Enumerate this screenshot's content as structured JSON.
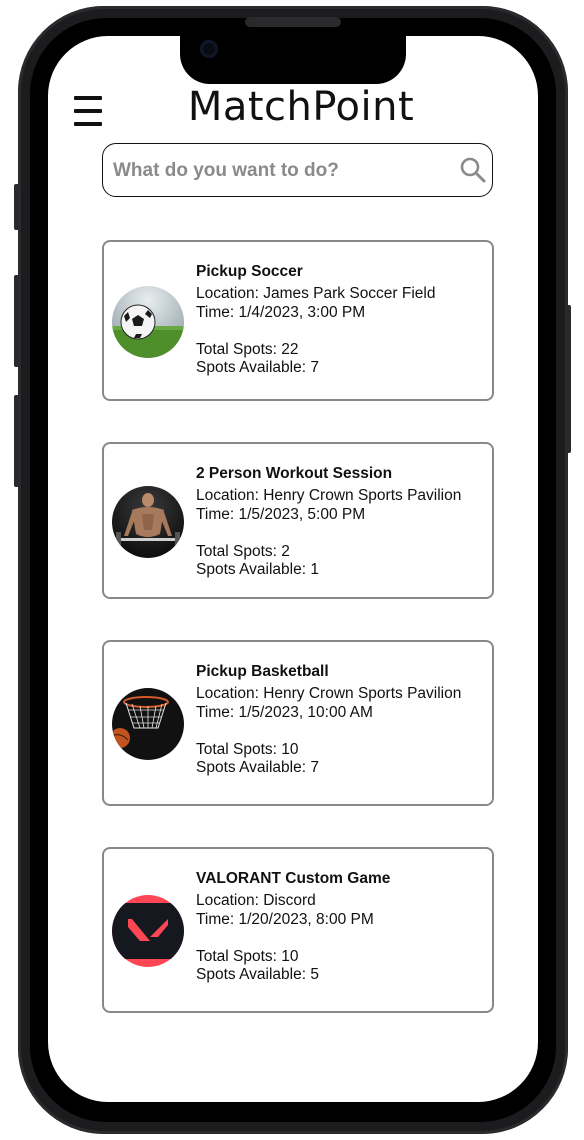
{
  "app": {
    "title": "MatchPoint"
  },
  "search": {
    "placeholder": "What do you want to do?"
  },
  "events": [
    {
      "title": "Pickup Soccer",
      "location": "Location: James Park Soccer Field",
      "time": "Time: 1/4/2023, 3:00 PM",
      "total_spots": "Total Spots: 22",
      "spots_available": "Spots Available: 7",
      "image": "soccer-ball-on-field"
    },
    {
      "title": "2 Person Workout Session",
      "location": "Location:  Henry Crown Sports Pavilion",
      "time": "Time: 1/5/2023, 5:00 PM",
      "total_spots": "Total Spots: 2",
      "spots_available": "Spots Available: 1",
      "image": "weightlifter"
    },
    {
      "title": "Pickup Basketball",
      "location": "Location: Henry Crown Sports Pavilion",
      "time": "Time: 1/5/2023, 10:00 AM",
      "total_spots": "Total Spots: 10",
      "spots_available": "Spots Available: 7",
      "image": "basketball-hoop"
    },
    {
      "title": "VALORANT Custom Game",
      "location": "Location: Discord",
      "time": "Time: 1/20/2023, 8:00 PM",
      "total_spots": "Total Spots: 10",
      "spots_available": "Spots Available: 5",
      "image": "valorant-logo"
    }
  ],
  "colors": {
    "valorant_red": "#ff4655",
    "card_border": "#888888"
  }
}
